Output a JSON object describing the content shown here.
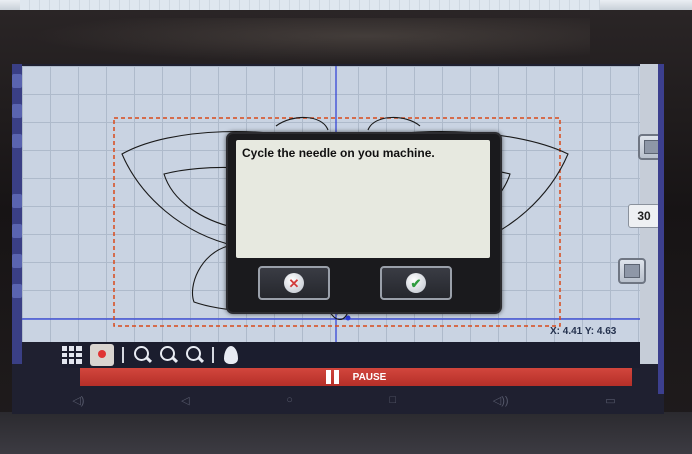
{
  "dialog": {
    "message": "Cycle the needle on you machine.",
    "cancel_icon": "x-circle-icon",
    "confirm_icon": "check-circle-icon"
  },
  "status": {
    "coordinates": "X: 4.41 Y: 4.63"
  },
  "side_panel": {
    "value": "30"
  },
  "toolbar": {
    "pause_label": "PAUSE"
  },
  "colors": {
    "dialog_bg": "#e7e9e0",
    "pause_bar": "#c23a32",
    "canvas_grid": "#c9d3e2",
    "design_outline": "#1a1a1a",
    "hoop_border": "#d94a1a",
    "crosshair": "#2a3bd6"
  }
}
